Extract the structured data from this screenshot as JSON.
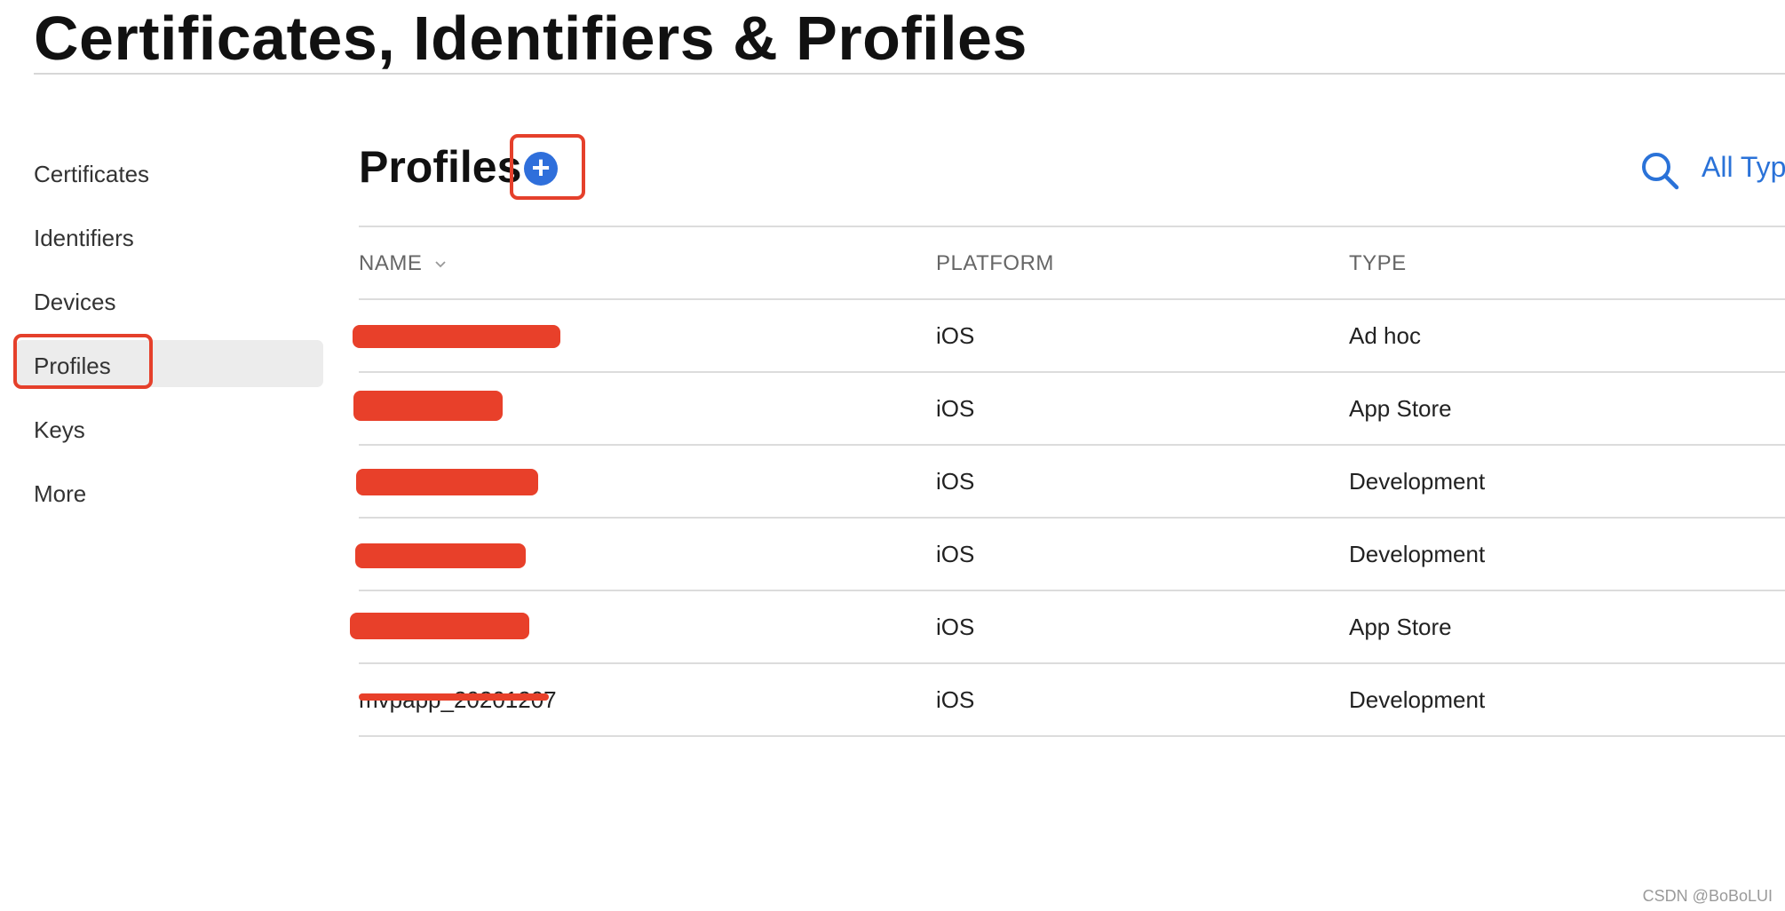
{
  "page": {
    "title": "Certificates, Identifiers & Profiles"
  },
  "sidebar": {
    "items": [
      {
        "label": "Certificates"
      },
      {
        "label": "Identifiers"
      },
      {
        "label": "Devices"
      },
      {
        "label": "Profiles",
        "selected": true
      },
      {
        "label": "Keys"
      },
      {
        "label": "More"
      }
    ]
  },
  "main": {
    "section_title": "Profiles",
    "add_icon": "plus-circle-icon",
    "add_symbol": "+",
    "search_icon": "search-icon",
    "filter_label": "All Typ",
    "table": {
      "columns": [
        "NAME",
        "PLATFORM",
        "TYPE"
      ],
      "rows": [
        {
          "name": "",
          "platform": "iOS",
          "type": "Ad hoc"
        },
        {
          "name": "",
          "platform": "iOS",
          "type": "App Store"
        },
        {
          "name": "",
          "platform": "iOS",
          "type": "Development"
        },
        {
          "name": "",
          "platform": "iOS",
          "type": "Development"
        },
        {
          "name": "",
          "platform": "iOS",
          "type": "App Store"
        },
        {
          "name": "mvpapp_20201207",
          "platform": "iOS",
          "type": "Development"
        }
      ]
    }
  },
  "watermark": "CSDN @BoBoLUI",
  "colors": {
    "accent": "#2a72d8",
    "annotation": "#e5402b",
    "selected_bg": "#ececec"
  }
}
